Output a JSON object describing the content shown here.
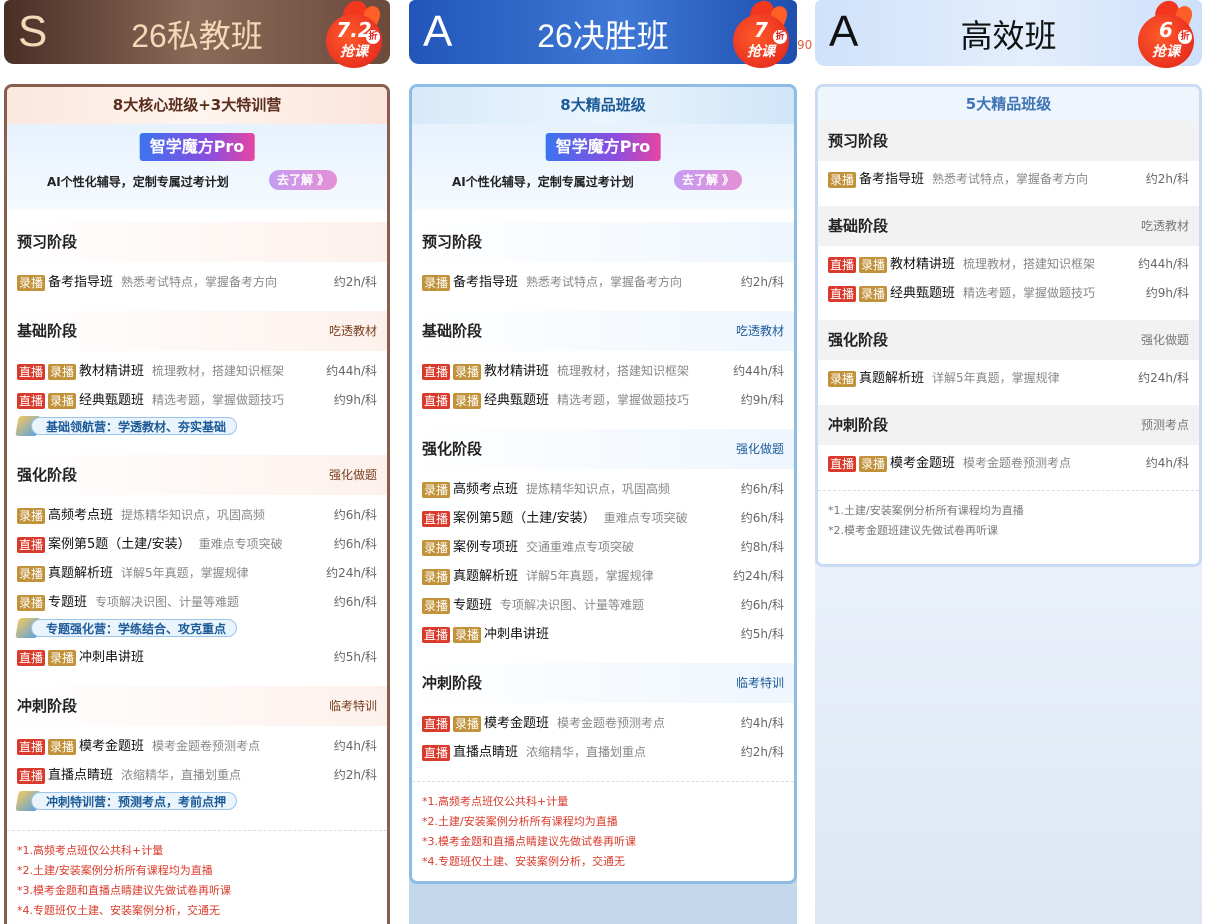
{
  "columns": [
    {
      "letter": "S",
      "name": "26私教班",
      "discount": {
        "num": "7.2",
        "unit": "折",
        "text": "抢课"
      },
      "title": "8大核心班级+3大特训营",
      "promo": {
        "badge": "智学魔方Pro",
        "text": "AI个性化辅导，定制专属过考计划",
        "button": "去了解 》"
      },
      "stages": [
        {
          "name": "预习阶段",
          "tag": "",
          "courses": [
            {
              "badges": [
                "录播"
              ],
              "name": "备考指导班",
              "desc": "熟悉考试特点，掌握备考方向",
              "dur": "约2h/科"
            }
          ]
        },
        {
          "name": "基础阶段",
          "tag": "吃透教材",
          "courses": [
            {
              "badges": [
                "直播",
                "录播"
              ],
              "name": "教材精讲班",
              "desc": "梳理教材，搭建知识框架",
              "dur": "约44h/科"
            },
            {
              "badges": [
                "直播",
                "录播"
              ],
              "name": "经典甄题班",
              "desc": "精选考题，掌握做题技巧",
              "dur": "约9h/科"
            }
          ],
          "camp": "基础领航营：学透教材、夯实基础"
        },
        {
          "name": "强化阶段",
          "tag": "强化做题",
          "courses": [
            {
              "badges": [
                "录播"
              ],
              "name": "高频考点班",
              "desc": "提炼精华知识点，巩固高频",
              "dur": "约6h/科"
            },
            {
              "badges": [
                "直播"
              ],
              "name": "案例第5题（土建/安装）",
              "desc": "重难点专项突破",
              "dur": "约6h/科"
            },
            {
              "badges": [
                "录播"
              ],
              "name": "真题解析班",
              "desc": "详解5年真题，掌握规律",
              "dur": "约24h/科"
            },
            {
              "badges": [
                "录播"
              ],
              "name": "专题班",
              "desc": "专项解决识图、计量等难题",
              "dur": "约6h/科"
            }
          ],
          "camp": "专题强化营：学练结合、攻克重点",
          "after": [
            {
              "badges": [
                "直播",
                "录播"
              ],
              "name": "冲刺串讲班",
              "desc": "",
              "dur": "约5h/科"
            }
          ]
        },
        {
          "name": "冲刺阶段",
          "tag": "临考特训",
          "courses": [
            {
              "badges": [
                "直播",
                "录播"
              ],
              "name": "模考金题班",
              "desc": "模考金题卷预测考点",
              "dur": "约4h/科"
            },
            {
              "badges": [
                "直播"
              ],
              "name": "直播点睛班",
              "desc": "浓缩精华，直播划重点",
              "dur": "约2h/科"
            }
          ],
          "camp": "冲刺特训营：预测考点，考前点押"
        }
      ],
      "notes": [
        "*1.高频考点班仅公共科+计量",
        "*2.土建/安装案例分析所有课程均为直播",
        "*3.模考金题和直播点睛建议先做试卷再听课",
        "*4.专题班仅土建、安装案例分析，交通无"
      ]
    },
    {
      "letter": "A",
      "name": "26决胜班",
      "discount": {
        "num": "7",
        "unit": "折",
        "text": "抢课"
      },
      "title": "8大精品班级",
      "promo": {
        "badge": "智学魔方Pro",
        "text": "AI个性化辅导，定制专属过考计划",
        "button": "去了解 》"
      },
      "stages": [
        {
          "name": "预习阶段",
          "tag": "",
          "courses": [
            {
              "badges": [
                "录播"
              ],
              "name": "备考指导班",
              "desc": "熟悉考试特点，掌握备考方向",
              "dur": "约2h/科"
            }
          ]
        },
        {
          "name": "基础阶段",
          "tag": "吃透教材",
          "courses": [
            {
              "badges": [
                "直播",
                "录播"
              ],
              "name": "教材精讲班",
              "desc": "梳理教材，搭建知识框架",
              "dur": "约44h/科"
            },
            {
              "badges": [
                "直播",
                "录播"
              ],
              "name": "经典甄题班",
              "desc": "精选考题，掌握做题技巧",
              "dur": "约9h/科"
            }
          ]
        },
        {
          "name": "强化阶段",
          "tag": "强化做题",
          "courses": [
            {
              "badges": [
                "录播"
              ],
              "name": "高频考点班",
              "desc": "提炼精华知识点，巩固高频",
              "dur": "约6h/科"
            },
            {
              "badges": [
                "直播"
              ],
              "name": "案例第5题（土建/安装）",
              "desc": "重难点专项突破",
              "dur": "约6h/科"
            },
            {
              "badges": [
                "录播"
              ],
              "name": "案例专项班",
              "desc": "交通重难点专项突破",
              "dur": "约8h/科"
            },
            {
              "badges": [
                "录播"
              ],
              "name": "真题解析班",
              "desc": "详解5年真题，掌握规律",
              "dur": "约24h/科"
            },
            {
              "badges": [
                "录播"
              ],
              "name": "专题班",
              "desc": "专项解决识图、计量等难题",
              "dur": "约6h/科"
            },
            {
              "badges": [
                "直播",
                "录播"
              ],
              "name": "冲刺串讲班",
              "desc": "",
              "dur": "约5h/科"
            }
          ]
        },
        {
          "name": "冲刺阶段",
          "tag": "临考特训",
          "courses": [
            {
              "badges": [
                "直播",
                "录播"
              ],
              "name": "模考金题班",
              "desc": "模考金题卷预测考点",
              "dur": "约4h/科"
            },
            {
              "badges": [
                "直播"
              ],
              "name": "直播点睛班",
              "desc": "浓缩精华，直播划重点",
              "dur": "约2h/科"
            }
          ]
        }
      ],
      "notes": [
        "*1.高频考点班仅公共科+计量",
        "*2.土建/安装案例分析所有课程均为直播",
        "*3.模考金题和直播点睛建议先做试卷再听课",
        "*4.专题班仅土建、安装案例分析，交通无"
      ]
    },
    {
      "letter": "A",
      "name": "高效班",
      "discount": {
        "num": "6",
        "unit": "折",
        "text": "抢课"
      },
      "title": "5大精品班级",
      "stages": [
        {
          "name": "预习阶段",
          "tag": "",
          "courses": [
            {
              "badges": [
                "录播"
              ],
              "name": "备考指导班",
              "desc": "熟悉考试特点，掌握备考方向",
              "dur": "约2h/科"
            }
          ]
        },
        {
          "name": "基础阶段",
          "tag": "吃透教材",
          "courses": [
            {
              "badges": [
                "直播",
                "录播"
              ],
              "name": "教材精讲班",
              "desc": "梳理教材，搭建知识框架",
              "dur": "约44h/科"
            },
            {
              "badges": [
                "直播",
                "录播"
              ],
              "name": "经典甄题班",
              "desc": "精选考题，掌握做题技巧",
              "dur": "约9h/科"
            }
          ]
        },
        {
          "name": "强化阶段",
          "tag": "强化做题",
          "courses": [
            {
              "badges": [
                "录播"
              ],
              "name": "真题解析班",
              "desc": "详解5年真题，掌握规律",
              "dur": "约24h/科"
            }
          ]
        },
        {
          "name": "冲刺阶段",
          "tag": "预测考点",
          "courses": [
            {
              "badges": [
                "直播",
                "录播"
              ],
              "name": "模考金题班",
              "desc": "模考金题卷预测考点",
              "dur": "约4h/科"
            }
          ]
        }
      ],
      "notes": [
        "*1.土建/安装案例分析所有课程均为直播",
        "*2.模考金题班建议先做试卷再听课"
      ]
    }
  ],
  "partial_side_text": "90",
  "colors": {
    "live": "#d93a2b",
    "recorded": "#c2923a",
    "camp_border": "#9ac4ec"
  }
}
